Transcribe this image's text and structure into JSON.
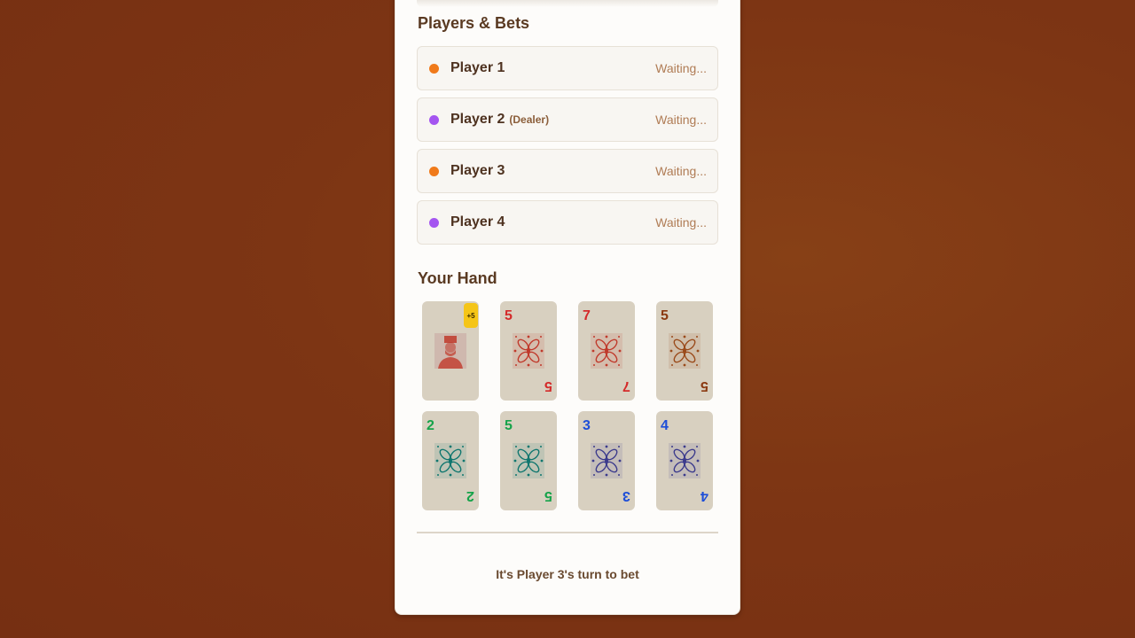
{
  "players_section": {
    "title": "Players & Bets",
    "players": [
      {
        "name": "Player 1",
        "tag": "",
        "status": "Waiting...",
        "color": "#f07a1a"
      },
      {
        "name": "Player 2",
        "tag": "(Dealer)",
        "status": "Waiting...",
        "color": "#a455f0"
      },
      {
        "name": "Player 3",
        "tag": "",
        "status": "Waiting...",
        "color": "#f07a1a"
      },
      {
        "name": "Player 4",
        "tag": "",
        "status": "Waiting...",
        "color": "#a455f0"
      }
    ]
  },
  "hand_section": {
    "title": "Your Hand",
    "cards": [
      {
        "rank": "",
        "suit_color": "#c0392b",
        "art": "portrait-icon",
        "badge": "+5"
      },
      {
        "rank": "5",
        "suit_color": "#d42a2a",
        "art": "red-pattern-icon",
        "badge": ""
      },
      {
        "rank": "7",
        "suit_color": "#d42a2a",
        "art": "red-pattern-icon",
        "badge": ""
      },
      {
        "rank": "5",
        "suit_color": "#8b3a12",
        "art": "brown-pattern-icon",
        "badge": ""
      },
      {
        "rank": "2",
        "suit_color": "#16a34a",
        "art": "green-pattern-icon",
        "badge": ""
      },
      {
        "rank": "5",
        "suit_color": "#16a34a",
        "art": "green-pattern-icon",
        "badge": ""
      },
      {
        "rank": "3",
        "suit_color": "#1d4ed8",
        "art": "blue-pattern-icon",
        "badge": ""
      },
      {
        "rank": "4",
        "suit_color": "#1d4ed8",
        "art": "blue-pattern-icon",
        "badge": ""
      }
    ]
  },
  "turn_message": "It's Player 3's turn to bet"
}
